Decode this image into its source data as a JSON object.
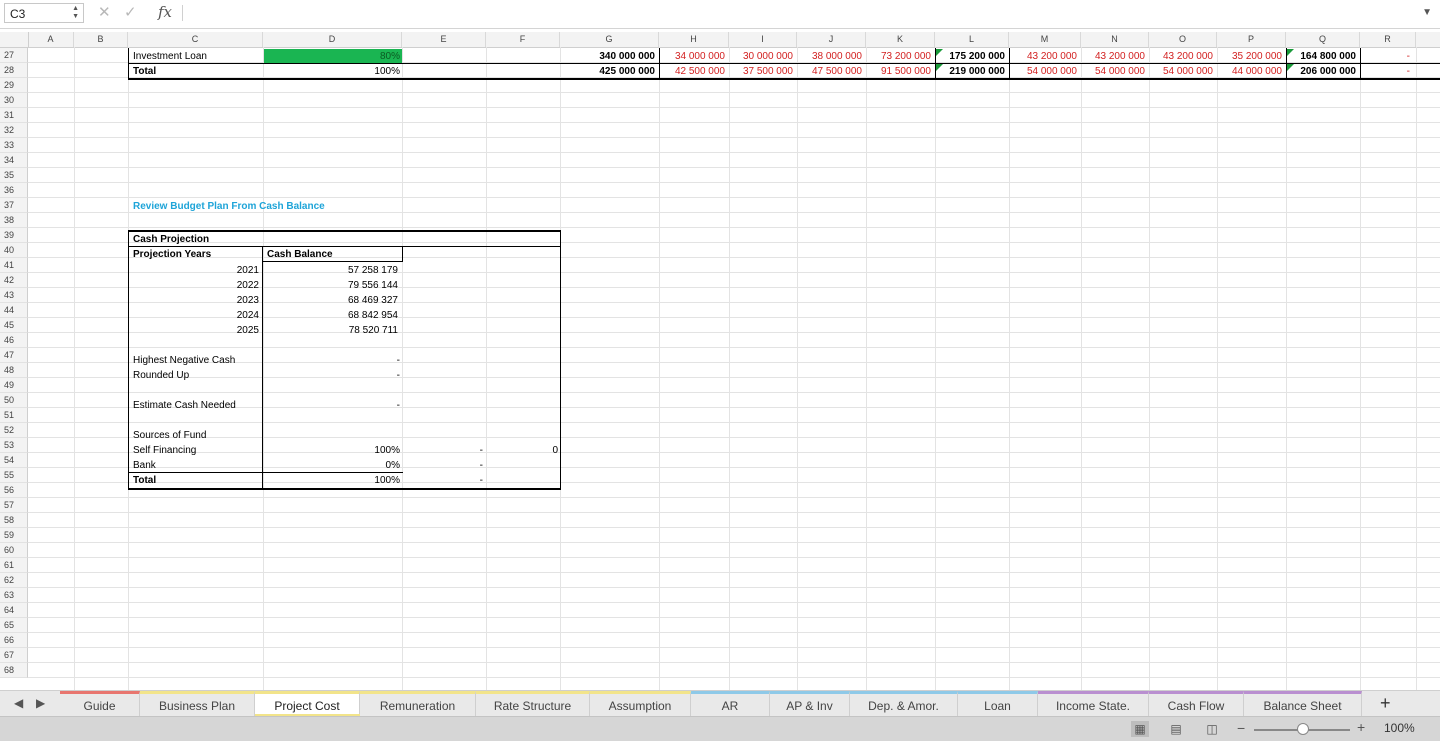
{
  "formula_bar": {
    "name_box": "C3",
    "formula": ""
  },
  "columns": [
    "A",
    "B",
    "C",
    "D",
    "E",
    "F",
    "G",
    "H",
    "I",
    "J",
    "K",
    "L",
    "M",
    "N",
    "O",
    "P",
    "Q",
    "R"
  ],
  "rows": [
    "27",
    "28",
    "29",
    "30",
    "31",
    "32",
    "33",
    "34",
    "35",
    "36",
    "37",
    "38",
    "39",
    "40",
    "41",
    "42",
    "43",
    "44",
    "45",
    "46",
    "47",
    "48",
    "49",
    "50",
    "51",
    "52",
    "53",
    "54",
    "55",
    "56",
    "57",
    "58",
    "59",
    "60",
    "61",
    "62",
    "63",
    "64",
    "65",
    "66",
    "67",
    "68"
  ],
  "top_rows": {
    "investment_loan": {
      "label": "Investment Loan",
      "pct": "80%",
      "values": [
        "340 000 000",
        "34 000 000",
        "30 000 000",
        "38 000 000",
        "73 200 000",
        "175 200 000",
        "43 200 000",
        "43 200 000",
        "43 200 000",
        "35 200 000",
        "164 800 000"
      ],
      "r": "-"
    },
    "total": {
      "label": "Total",
      "pct": "100%",
      "values": [
        "425 000 000",
        "42 500 000",
        "37 500 000",
        "47 500 000",
        "91 500 000",
        "219 000 000",
        "54 000 000",
        "54 000 000",
        "54 000 000",
        "44 000 000",
        "206 000 000"
      ],
      "r": "-"
    }
  },
  "review_title": "Review Budget Plan From Cash Balance",
  "cash_projection": {
    "title": "Cash Projection",
    "col_years": "Projection Years",
    "col_balance": "Cash Balance",
    "years": [
      "2021",
      "2022",
      "2023",
      "2024",
      "2025"
    ],
    "balances": [
      "57 258 179",
      "79 556 144",
      "68 469 327",
      "68 842 954",
      "78 520 711"
    ],
    "highest_negative": "Highest Negative Cash",
    "highest_negative_val": "-",
    "rounded_up": "Rounded Up",
    "rounded_up_val": "-",
    "estimate": "Estimate Cash Needed",
    "estimate_val": "-",
    "sources": "Sources of Fund",
    "self_financing": "Self Financing",
    "self_financing_pct": "100%",
    "self_financing_e": "-",
    "self_financing_f": "0",
    "bank": "Bank",
    "bank_pct": "0%",
    "bank_e": "-",
    "total": "Total",
    "total_pct": "100%",
    "total_e": "-"
  },
  "tabs": [
    {
      "label": "Guide",
      "color": "#e8766f"
    },
    {
      "label": "Business Plan",
      "color": "#f2e48a"
    },
    {
      "label": "Project Cost",
      "color": "#f2e48a"
    },
    {
      "label": "Remuneration",
      "color": "#f2e48a"
    },
    {
      "label": "Rate Structure",
      "color": "#f2e48a"
    },
    {
      "label": "Assumption",
      "color": "#f2e48a"
    },
    {
      "label": "AR",
      "color": "#8ec9e8"
    },
    {
      "label": "AP & Inv",
      "color": "#8ec9e8"
    },
    {
      "label": "Dep. & Amor.",
      "color": "#8ec9e8"
    },
    {
      "label": "Loan",
      "color": "#8ec9e8"
    },
    {
      "label": "Income State.",
      "color": "#b98fd0"
    },
    {
      "label": "Cash Flow",
      "color": "#b98fd0"
    },
    {
      "label": "Balance Sheet",
      "color": "#b98fd0"
    }
  ],
  "active_tab": "Project Cost",
  "zoom": "100%",
  "colors": {
    "green_fill": "#1ab552",
    "red_text": "#d21f1f",
    "blue_title": "#1ea4d8"
  }
}
